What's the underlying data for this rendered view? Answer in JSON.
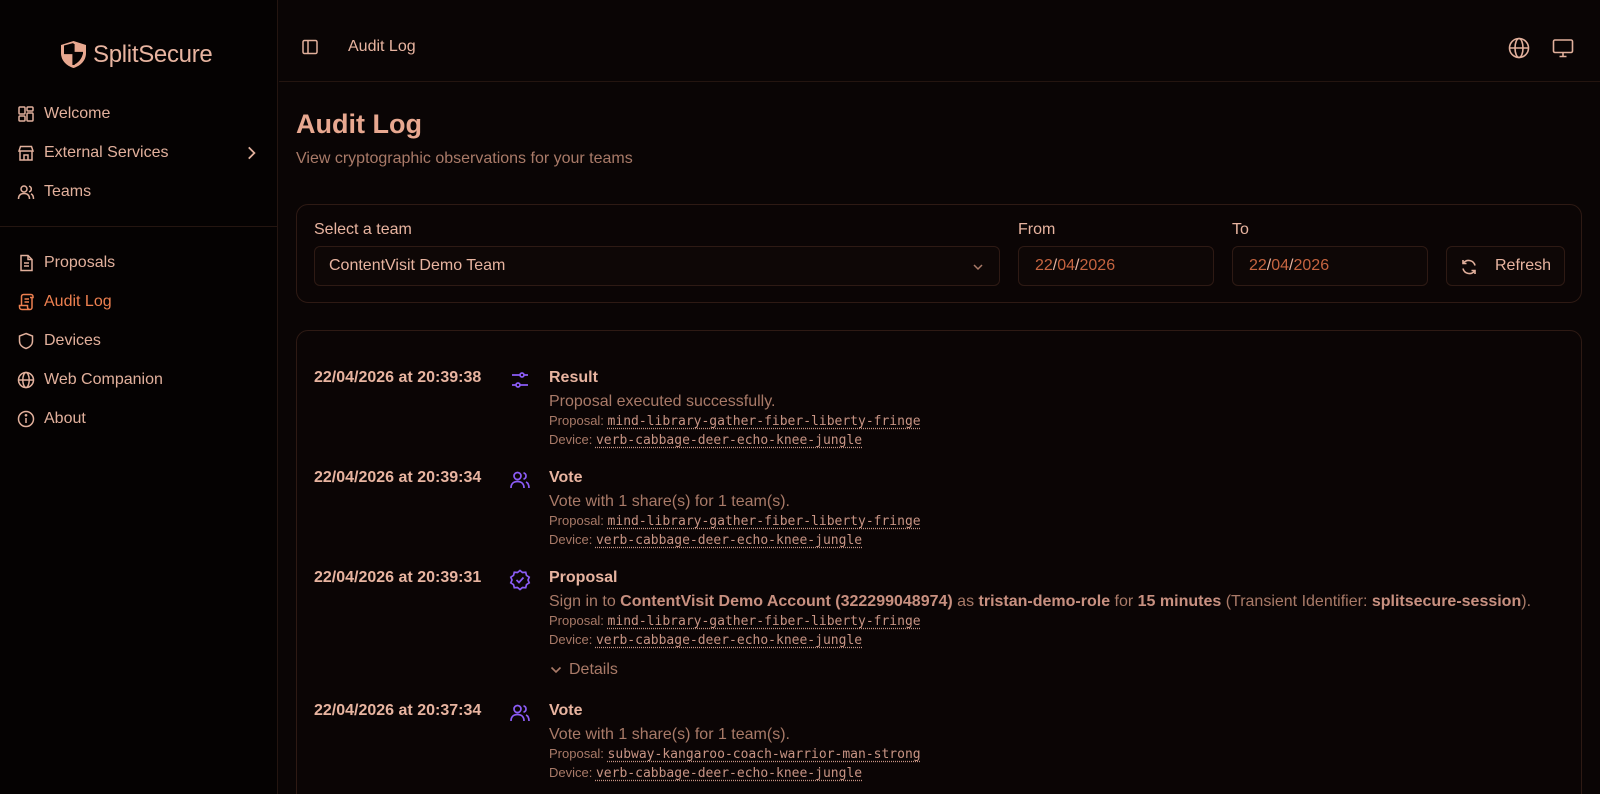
{
  "app": {
    "name": "SplitSecure"
  },
  "sidebar": {
    "primary": [
      {
        "label": "Welcome",
        "icon": "dashboard-icon"
      },
      {
        "label": "External Services",
        "icon": "store-icon"
      },
      {
        "label": "Teams",
        "icon": "users-icon"
      }
    ],
    "secondary": [
      {
        "label": "Proposals",
        "icon": "document-icon"
      },
      {
        "label": "Audit Log",
        "icon": "scroll-icon",
        "active": true
      },
      {
        "label": "Devices",
        "icon": "shield-icon"
      },
      {
        "label": "Web Companion",
        "icon": "globe-icon"
      },
      {
        "label": "About",
        "icon": "info-icon"
      }
    ]
  },
  "header": {
    "breadcrumb": "Audit Log"
  },
  "page": {
    "title": "Audit Log",
    "subtitle": "View cryptographic observations for your teams"
  },
  "filters": {
    "team_label": "Select a team",
    "team_value": "ContentVisit Demo Team",
    "from_label": "From",
    "to_label": "To",
    "from": {
      "day": "22",
      "month": "04",
      "year": "2026"
    },
    "to": {
      "day": "22",
      "month": "04",
      "year": "2026"
    },
    "refresh_label": "Refresh"
  },
  "log": {
    "proposal_label": "Proposal:",
    "device_label": "Device:",
    "details_label": "Details",
    "entries": [
      {
        "timestamp": "22/04/2026 at 20:39:38",
        "type": "Result",
        "icon": "sliders-icon",
        "description": "Proposal executed successfully.",
        "proposal": "mind-library-gather-fiber-liberty-fringe",
        "device": "verb-cabbage-deer-echo-knee-jungle"
      },
      {
        "timestamp": "22/04/2026 at 20:39:34",
        "type": "Vote",
        "icon": "users-icon",
        "description": "Vote with 1 share(s) for 1 team(s).",
        "proposal": "mind-library-gather-fiber-liberty-fringe",
        "device": "verb-cabbage-deer-echo-knee-jungle"
      },
      {
        "timestamp": "22/04/2026 at 20:39:31",
        "type": "Proposal",
        "icon": "badge-check-icon",
        "description_parts": {
          "p1": "Sign in to ",
          "account": "ContentVisit Demo Account (322299048974)",
          "p2": " as ",
          "role": "tristan-demo-role",
          "p3": " for ",
          "duration": "15 minutes",
          "p4": " (Transient Identifier: ",
          "identifier": "splitsecure-session",
          "p5": ")."
        },
        "proposal": "mind-library-gather-fiber-liberty-fringe",
        "device": "verb-cabbage-deer-echo-knee-jungle"
      },
      {
        "timestamp": "22/04/2026 at 20:37:34",
        "type": "Vote",
        "icon": "users-icon",
        "description": "Vote with 1 share(s) for 1 team(s).",
        "proposal": "subway-kangaroo-coach-warrior-man-strong",
        "device": "verb-cabbage-deer-echo-knee-jungle"
      }
    ]
  },
  "colors": {
    "accent": "#ee8050",
    "text": "#e8b4a0",
    "muted": "#a97a68",
    "icon_purple": "#8b5cf6",
    "background": "#0a0505"
  }
}
